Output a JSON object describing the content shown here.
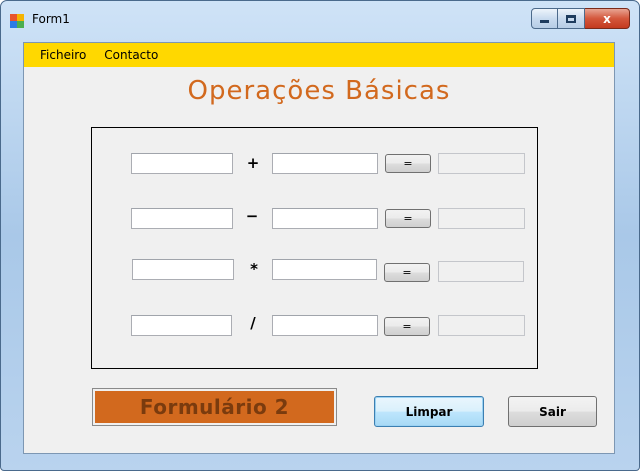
{
  "window": {
    "title": "Form1",
    "close_glyph": "x",
    "accent_color": "#d2691e",
    "menu_color": "#ffd800"
  },
  "menu": {
    "items": [
      {
        "label": "Ficheiro"
      },
      {
        "label": "Contacto"
      }
    ]
  },
  "page": {
    "heading": "Operações Básicas"
  },
  "operations": [
    {
      "operator": "+",
      "equals_label": "=",
      "operand1": "",
      "operand2": "",
      "result": ""
    },
    {
      "operator": "−",
      "equals_label": "=",
      "operand1": "",
      "operand2": "",
      "result": ""
    },
    {
      "operator": "*",
      "equals_label": "=",
      "operand1": "",
      "operand2": "",
      "result": ""
    },
    {
      "operator": "/",
      "equals_label": "=",
      "operand1": "",
      "operand2": "",
      "result": ""
    }
  ],
  "buttons": {
    "form2_label": "Formulário 2",
    "clear_label": "Limpar",
    "exit_label": "Sair"
  },
  "icons": {
    "app": "windows-form-icon",
    "minimize": "minimize-icon",
    "maximize": "maximize-icon",
    "close": "close-icon"
  }
}
